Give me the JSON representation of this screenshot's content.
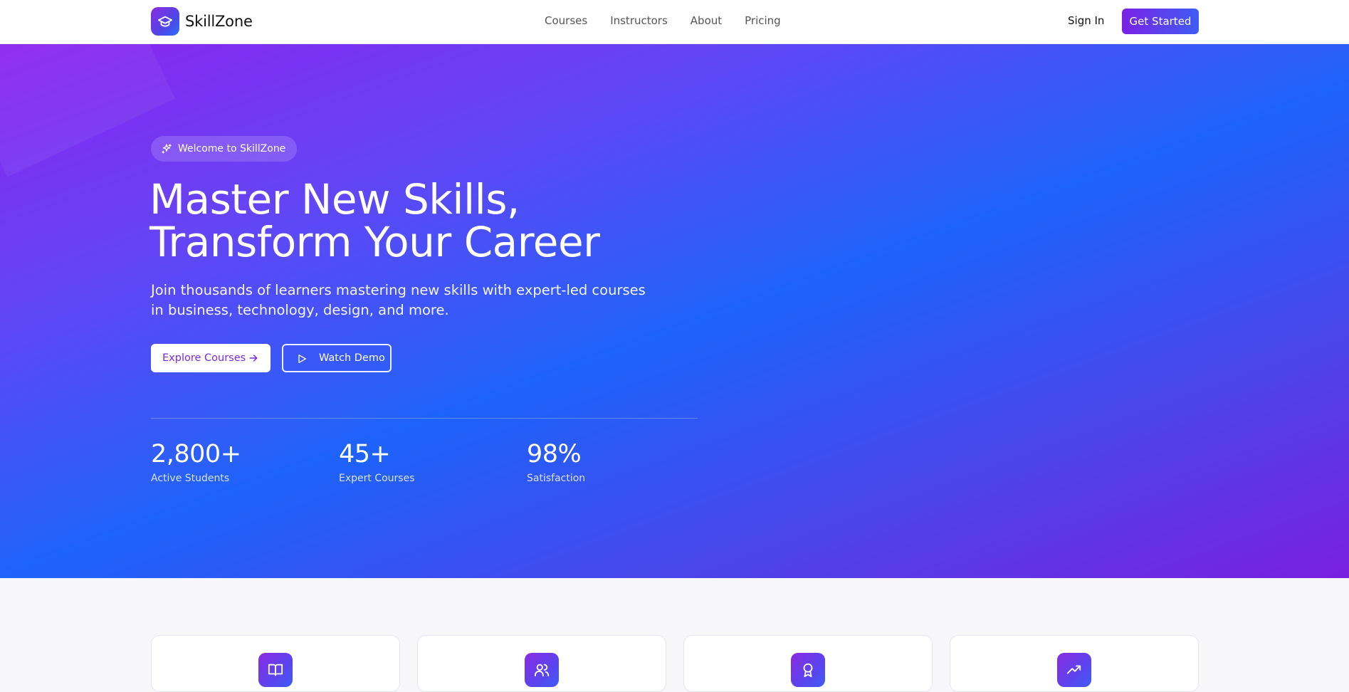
{
  "nav": {
    "brand": "SkillZone",
    "brand_icon": "graduation-cap-icon",
    "links": [
      {
        "label": "Courses"
      },
      {
        "label": "Instructors"
      },
      {
        "label": "About"
      },
      {
        "label": "Pricing"
      }
    ],
    "sign_in": "Sign In",
    "get_started": "Get Started"
  },
  "hero": {
    "badge": "Welcome to SkillZone",
    "badge_icon": "sparkles-icon",
    "headline_line1": "Master New Skills,",
    "headline_line2": "Transform Your Career",
    "subhead": "Join thousands of learners mastering new skills with expert-led courses in business, technology, design, and more.",
    "explore_label": "Explore Courses",
    "explore_icon": "arrow-right-icon",
    "demo_label": "Watch Demo",
    "demo_icon": "play-icon",
    "stats": [
      {
        "value": "2,800+",
        "label": "Active Students"
      },
      {
        "value": "45+",
        "label": "Expert Courses"
      },
      {
        "value": "98%",
        "label": "Satisfaction"
      }
    ]
  },
  "features": [
    {
      "icon": "book-open-icon"
    },
    {
      "icon": "users-icon"
    },
    {
      "icon": "award-icon"
    },
    {
      "icon": "trending-up-icon"
    }
  ],
  "colors": {
    "accent": "#7a22e6",
    "accent_blue": "#3f5cf5",
    "hero_blue": "#1d63fa",
    "hero_purple": "#8b24ee"
  }
}
